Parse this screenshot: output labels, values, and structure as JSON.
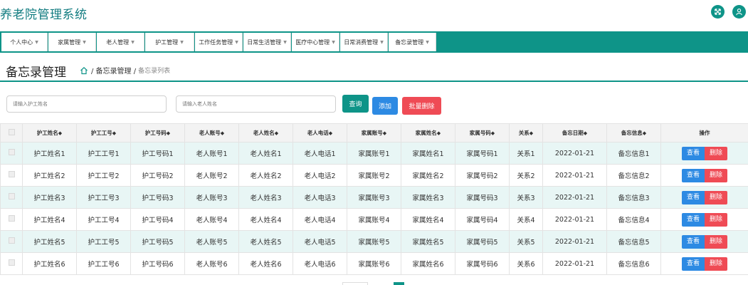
{
  "app": {
    "title": "养老院管理系统"
  },
  "nav": {
    "items": [
      "个人中心",
      "家属管理",
      "老人管理",
      "护工管理",
      "工作任务管理",
      "日常生活管理",
      "医疗中心管理",
      "日常消费管理",
      "备忘录管理"
    ],
    "accent": "#0e9488"
  },
  "page": {
    "title": "备忘录管理",
    "breadcrumb": {
      "parent": "/ 备忘录管理 /",
      "current": "备忘录列表"
    }
  },
  "search": {
    "nurse_placeholder": "请输入护工姓名",
    "elder_placeholder": "请输入老人姓名",
    "query_label": "查询",
    "add_label": "添加",
    "batch_delete_label": "批量删除"
  },
  "table": {
    "headers": [
      "护工姓名",
      "护工工号",
      "护工号码",
      "老人账号",
      "老人姓名",
      "老人电话",
      "家属账号",
      "家属姓名",
      "家属号码",
      "关系",
      "备忘日期",
      "备忘信息",
      "操作"
    ],
    "rows": [
      [
        "护工姓名1",
        "护工工号1",
        "护工号码1",
        "老人账号1",
        "老人姓名1",
        "老人电话1",
        "家属账号1",
        "家属姓名1",
        "家属号码1",
        "关系1",
        "2022-01-21",
        "备忘信息1"
      ],
      [
        "护工姓名2",
        "护工工号2",
        "护工号码2",
        "老人账号2",
        "老人姓名2",
        "老人电话2",
        "家属账号2",
        "家属姓名2",
        "家属号码2",
        "关系2",
        "2022-01-21",
        "备忘信息2"
      ],
      [
        "护工姓名3",
        "护工工号3",
        "护工号码3",
        "老人账号3",
        "老人姓名3",
        "老人电话3",
        "家属账号3",
        "家属姓名3",
        "家属号码3",
        "关系3",
        "2022-01-21",
        "备忘信息3"
      ],
      [
        "护工姓名4",
        "护工工号4",
        "护工号码4",
        "老人账号4",
        "老人姓名4",
        "老人电话4",
        "家属账号4",
        "家属姓名4",
        "家属号码4",
        "关系4",
        "2022-01-21",
        "备忘信息4"
      ],
      [
        "护工姓名5",
        "护工工号5",
        "护工号码5",
        "老人账号5",
        "老人姓名5",
        "老人电话5",
        "家属账号5",
        "家属姓名5",
        "家属号码5",
        "关系5",
        "2022-01-21",
        "备忘信息5"
      ],
      [
        "护工姓名6",
        "护工工号6",
        "护工号码6",
        "老人账号6",
        "老人姓名6",
        "老人电话6",
        "家属账号6",
        "家属姓名6",
        "家属号码6",
        "关系6",
        "2022-01-21",
        "备忘信息6"
      ]
    ],
    "view_label": "查看",
    "delete_label": "删除"
  },
  "colors": {
    "query": "#0e9488",
    "add": "#2d8ae3",
    "delete": "#ef4b55",
    "row_alt": "#e8f6f5"
  }
}
